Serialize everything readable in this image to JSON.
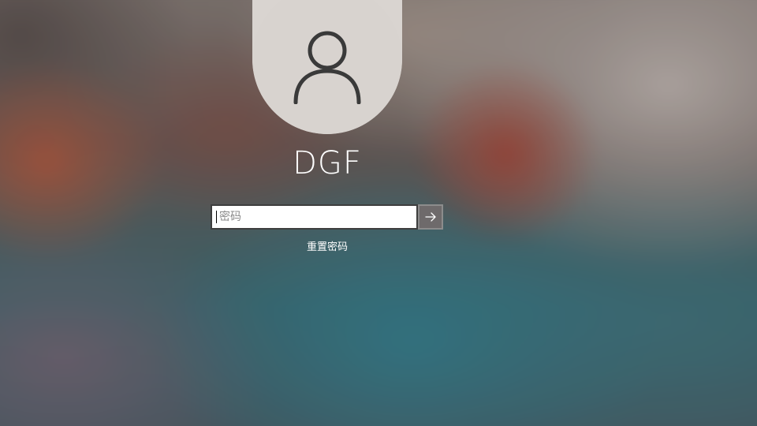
{
  "user": {
    "name": "DGF",
    "avatar_icon": "user-silhouette-icon"
  },
  "password": {
    "placeholder": "密码",
    "value": "",
    "submit_icon": "arrow-right-icon"
  },
  "links": {
    "reset_password": "重置密码"
  }
}
